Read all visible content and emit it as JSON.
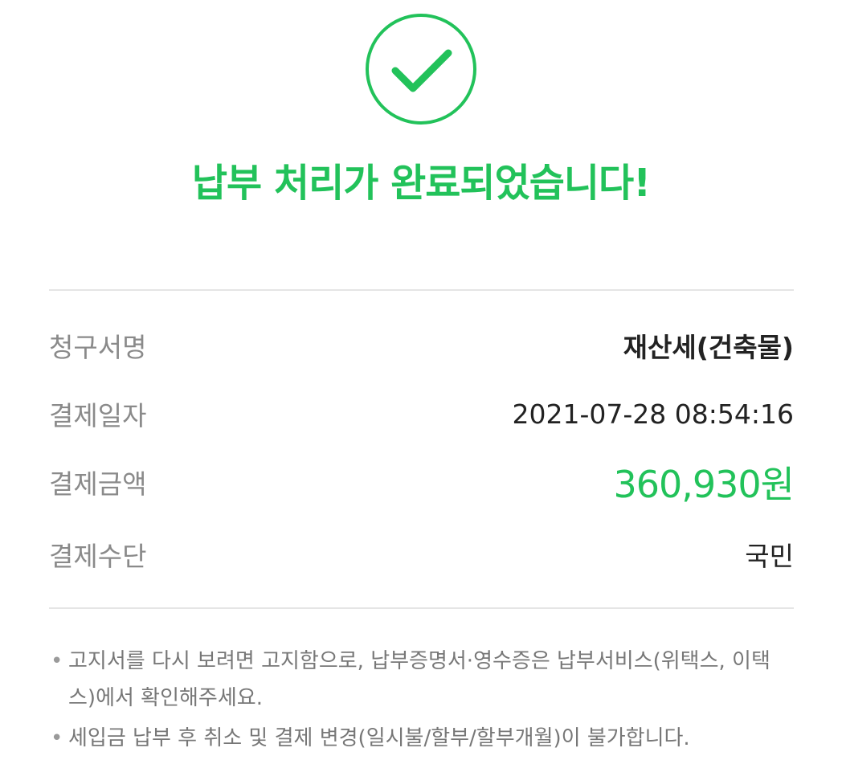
{
  "headline": "납부 처리가 완료되었습니다!",
  "colors": {
    "accent_green": "#22c25a",
    "label_gray": "#8a8a8a",
    "divider": "#e5e5e5"
  },
  "icon": "check-circle-icon",
  "details": [
    {
      "label": "청구서명",
      "value": "재산세(건축물)"
    },
    {
      "label": "결제일자",
      "value": "2021-07-28 08:54:16"
    },
    {
      "label": "결제금액",
      "value": "360,930원"
    },
    {
      "label": "결제수단",
      "value": "국민"
    }
  ],
  "notes": [
    "고지서를 다시 보려면 고지함으로, 납부증명서·영수증은 납부서비스(위택스, 이택스)에서 확인해주세요.",
    "세입금 납부 후 취소 및 결제 변경(일시불/할부/할부개월)이 불가합니다."
  ],
  "note_bullet": "•"
}
